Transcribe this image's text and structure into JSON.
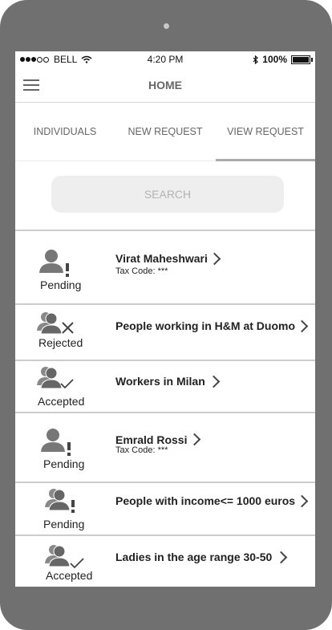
{
  "status_bar": {
    "carrier": "BELL",
    "time": "4:20 PM",
    "battery": "100%"
  },
  "header": {
    "title": "HOME"
  },
  "tabs": [
    {
      "label": "INDIVIDUALS"
    },
    {
      "label": "NEW REQUEST"
    },
    {
      "label": "VIEW REQUEST",
      "selected": true
    }
  ],
  "search": {
    "placeholder": "SEARCH"
  },
  "requests": [
    {
      "title": "Virat Maheshwari",
      "subtitle": "Tax Code: ***",
      "status": "Pending",
      "icon": "person-alert-icon"
    },
    {
      "title": "People working in H&M at Duomo",
      "status": "Rejected",
      "icon": "group-rejected-icon"
    },
    {
      "title": "Workers in Milan",
      "status": "Accepted",
      "icon": "group-accepted-icon"
    },
    {
      "title": "Emrald Rossi",
      "subtitle": "Tax Code: ***",
      "status": "Pending",
      "icon": "person-alert-icon"
    },
    {
      "title": "People with income<= 1000 euros",
      "status": "Pending",
      "icon": "group-alert-icon"
    },
    {
      "title": "Ladies in the age range 30-50",
      "status": "Accepted",
      "icon": "group-accepted-icon"
    }
  ]
}
